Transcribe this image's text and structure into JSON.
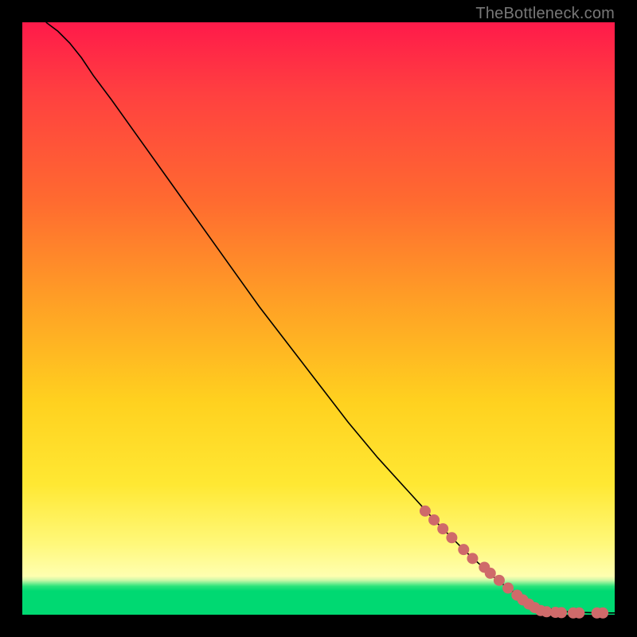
{
  "watermark": "TheBottleneck.com",
  "colors": {
    "curve": "#000000",
    "marker_fill": "#cf6a6a",
    "marker_stroke": "#b85a5a"
  },
  "chart_data": {
    "type": "line",
    "title": "",
    "xlabel": "",
    "ylabel": "",
    "xlim": [
      0,
      100
    ],
    "ylim": [
      0,
      100
    ],
    "series": [
      {
        "name": "curve",
        "x": [
          4,
          6,
          8,
          10,
          12,
          15,
          20,
          25,
          30,
          35,
          40,
          45,
          50,
          55,
          60,
          65,
          70,
          75,
          80,
          84,
          86,
          88,
          90,
          92,
          94,
          96,
          98,
          100
        ],
        "y": [
          100,
          98.5,
          96.5,
          94,
          91,
          87,
          80,
          73,
          66,
          59,
          52,
          45.5,
          39,
          32.5,
          26.5,
          21,
          15.5,
          10.5,
          6,
          3,
          2,
          1.3,
          0.8,
          0.5,
          0.4,
          0.35,
          0.3,
          0.3
        ]
      }
    ],
    "markers": [
      {
        "x": 68,
        "y": 17.5
      },
      {
        "x": 69.5,
        "y": 16
      },
      {
        "x": 71,
        "y": 14.5
      },
      {
        "x": 72.5,
        "y": 13
      },
      {
        "x": 74.5,
        "y": 11
      },
      {
        "x": 76,
        "y": 9.5
      },
      {
        "x": 78,
        "y": 8
      },
      {
        "x": 79,
        "y": 7
      },
      {
        "x": 80.5,
        "y": 5.8
      },
      {
        "x": 82,
        "y": 4.5
      },
      {
        "x": 83.5,
        "y": 3.3
      },
      {
        "x": 84.5,
        "y": 2.5
      },
      {
        "x": 85.5,
        "y": 1.8
      },
      {
        "x": 86.5,
        "y": 1.2
      },
      {
        "x": 87.5,
        "y": 0.7
      },
      {
        "x": 88.5,
        "y": 0.5
      },
      {
        "x": 90,
        "y": 0.4
      },
      {
        "x": 91,
        "y": 0.35
      },
      {
        "x": 93,
        "y": 0.3
      },
      {
        "x": 94,
        "y": 0.3
      },
      {
        "x": 97,
        "y": 0.3
      },
      {
        "x": 98,
        "y": 0.3
      }
    ],
    "marker_radius_px": 7
  }
}
